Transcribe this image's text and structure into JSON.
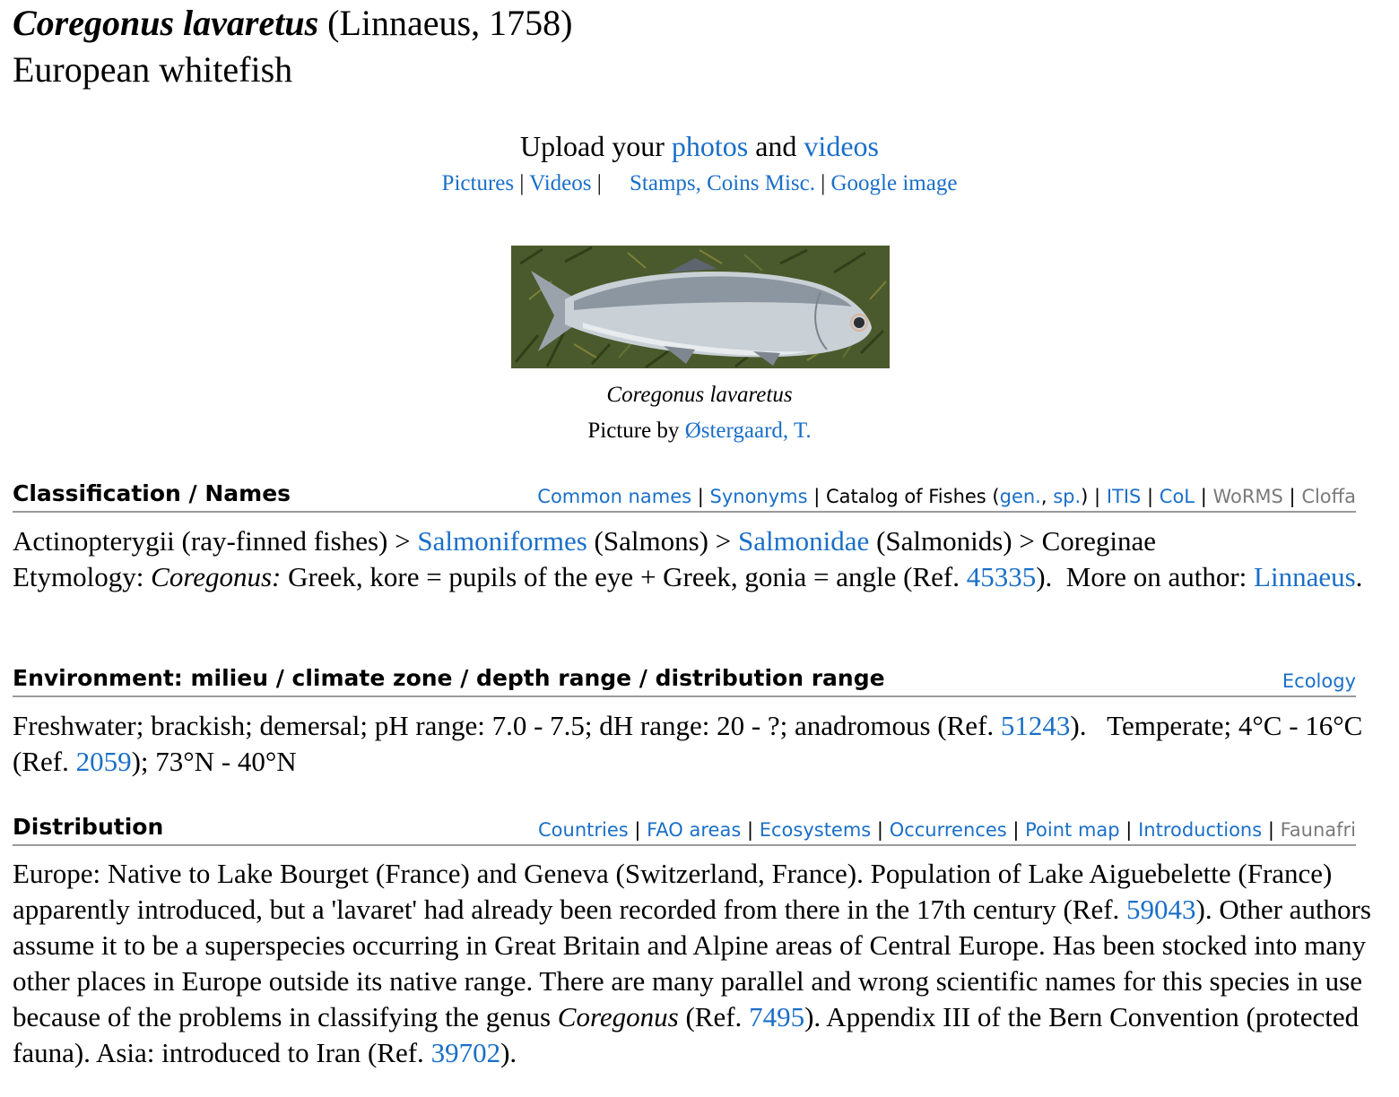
{
  "header": {
    "scientific_name": "Coregonus lavaretus",
    "authority": " (Linnaeus, 1758)",
    "common_name": "European whitefish"
  },
  "media": {
    "upload_prefix": "Upload your ",
    "photos_link": "photos",
    "and": " and ",
    "videos_link": "videos",
    "links": [
      "Pictures",
      "Videos",
      "Stamps, Coins Misc.",
      "Google image"
    ],
    "caption": "Coregonus lavaretus",
    "credit_prefix": "Picture by ",
    "credit_link": "Østergaard, T."
  },
  "classification": {
    "heading": "Classification / Names",
    "links": {
      "common_names": "Common names",
      "synonyms": "Synonyms",
      "catalog_prefix": "Catalog of Fishes (",
      "gen": "gen.",
      "comma": ", ",
      "sp": "sp.",
      "catalog_suffix": ")",
      "itis": "ITIS",
      "col": "CoL",
      "worms": "WoRMS",
      "cloffa": "Cloffa"
    },
    "lineage": {
      "t1": "Actinopterygii (ray-finned fishes) > ",
      "order": "Salmoniformes",
      "t2": " (Salmons) > ",
      "family": "Salmonidae",
      "t3": " (Salmonids) > Coreginae"
    },
    "etymology": {
      "label": "Etymology: ",
      "genus": "Coregonus:",
      "text": " Greek, kore = pupils of the eye + Greek, gonia = angle (Ref. ",
      "ref": "45335",
      "more": ").  More on author: ",
      "author": "Linnaeus",
      "end": "."
    }
  },
  "environment": {
    "heading": "Environment: milieu / climate zone / depth range / distribution range",
    "link": "Ecology",
    "t1": "Freshwater; brackish; demersal; pH range: 7.0 - 7.5; dH range: 20 - ?; anadromous (Ref. ",
    "ref1": "51243",
    "t2": ").   Temperate; 4°C - 16°C (Ref. ",
    "ref2": "2059",
    "t3": "); 73°N - 40°N"
  },
  "distribution": {
    "heading": "Distribution",
    "links": [
      "Countries",
      "FAO areas",
      "Ecosystems",
      "Occurrences",
      "Point map",
      "Introductions"
    ],
    "gray_link": "Faunafri",
    "t1": "Europe: Native to Lake Bourget (France) and Geneva (Switzerland, France). Population of Lake Aiguebelette (France) apparently introduced, but a 'lavaret' had already been recorded from there in the 17th century (Ref. ",
    "ref1": "59043",
    "t2": "). Other authors assume it to be a superspecies occurring in Great Britain and Alpine areas of Central Europe. Has been stocked into many other places in Europe outside its native range. There are many parallel and wrong scientific names for this species in use because of the problems in classifying the genus ",
    "genus": "Coregonus",
    "t3": " (Ref. ",
    "ref2": "7495",
    "t4": "). Appendix III of the Bern Convention (protected fauna). Asia: introduced to Iran (Ref. ",
    "ref3": "39702",
    "t5": ")."
  },
  "colors": {
    "link": "#1a6fc8",
    "muted_link": "#7a7a7a",
    "rule": "#9a9a9a"
  }
}
